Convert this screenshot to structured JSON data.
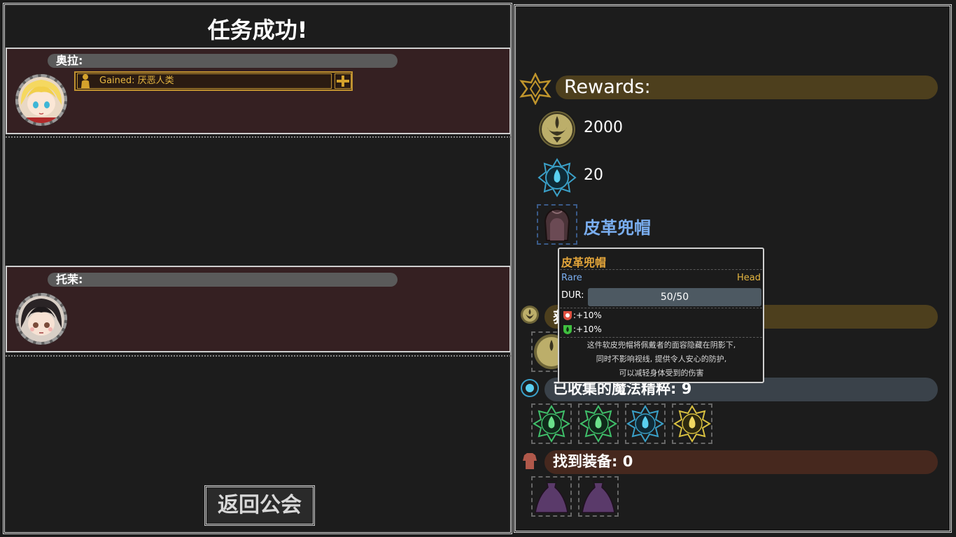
{
  "title": "任务成功!",
  "mercenaries": [
    {
      "name": "奥拉:",
      "trait_gained": "Gained: 厌恶人类"
    },
    {
      "name": "托茉:"
    }
  ],
  "return_button": "返回公会",
  "rewards": {
    "title": "Rewards:",
    "gold": "2000",
    "essence": "20",
    "item_name": "皮革兜帽"
  },
  "tooltip": {
    "title": "皮革兜帽",
    "rarity": "Rare",
    "slot": "Head",
    "dur_label": "DUR:",
    "dur_value": "50/50",
    "stat1": ":+10%",
    "stat2": ":+10%",
    "desc1": "这件软皮兜帽将佩戴者的面容隐藏在阴影下,",
    "desc2": "同时不影响视线, 提供令人安心的防护,",
    "desc3": "可以减轻身体受到的伤害"
  },
  "gold_section": {
    "label": "获"
  },
  "essence_section": {
    "label": "已收集的魔法精粹: 9"
  },
  "equipment_section": {
    "label": "找到装备: 0"
  },
  "colors": {
    "gold_bar": "#4d3f1d",
    "essence_bar": "#3a424a",
    "equip_bar": "#46281e",
    "item_blue": "#7aaef0"
  }
}
